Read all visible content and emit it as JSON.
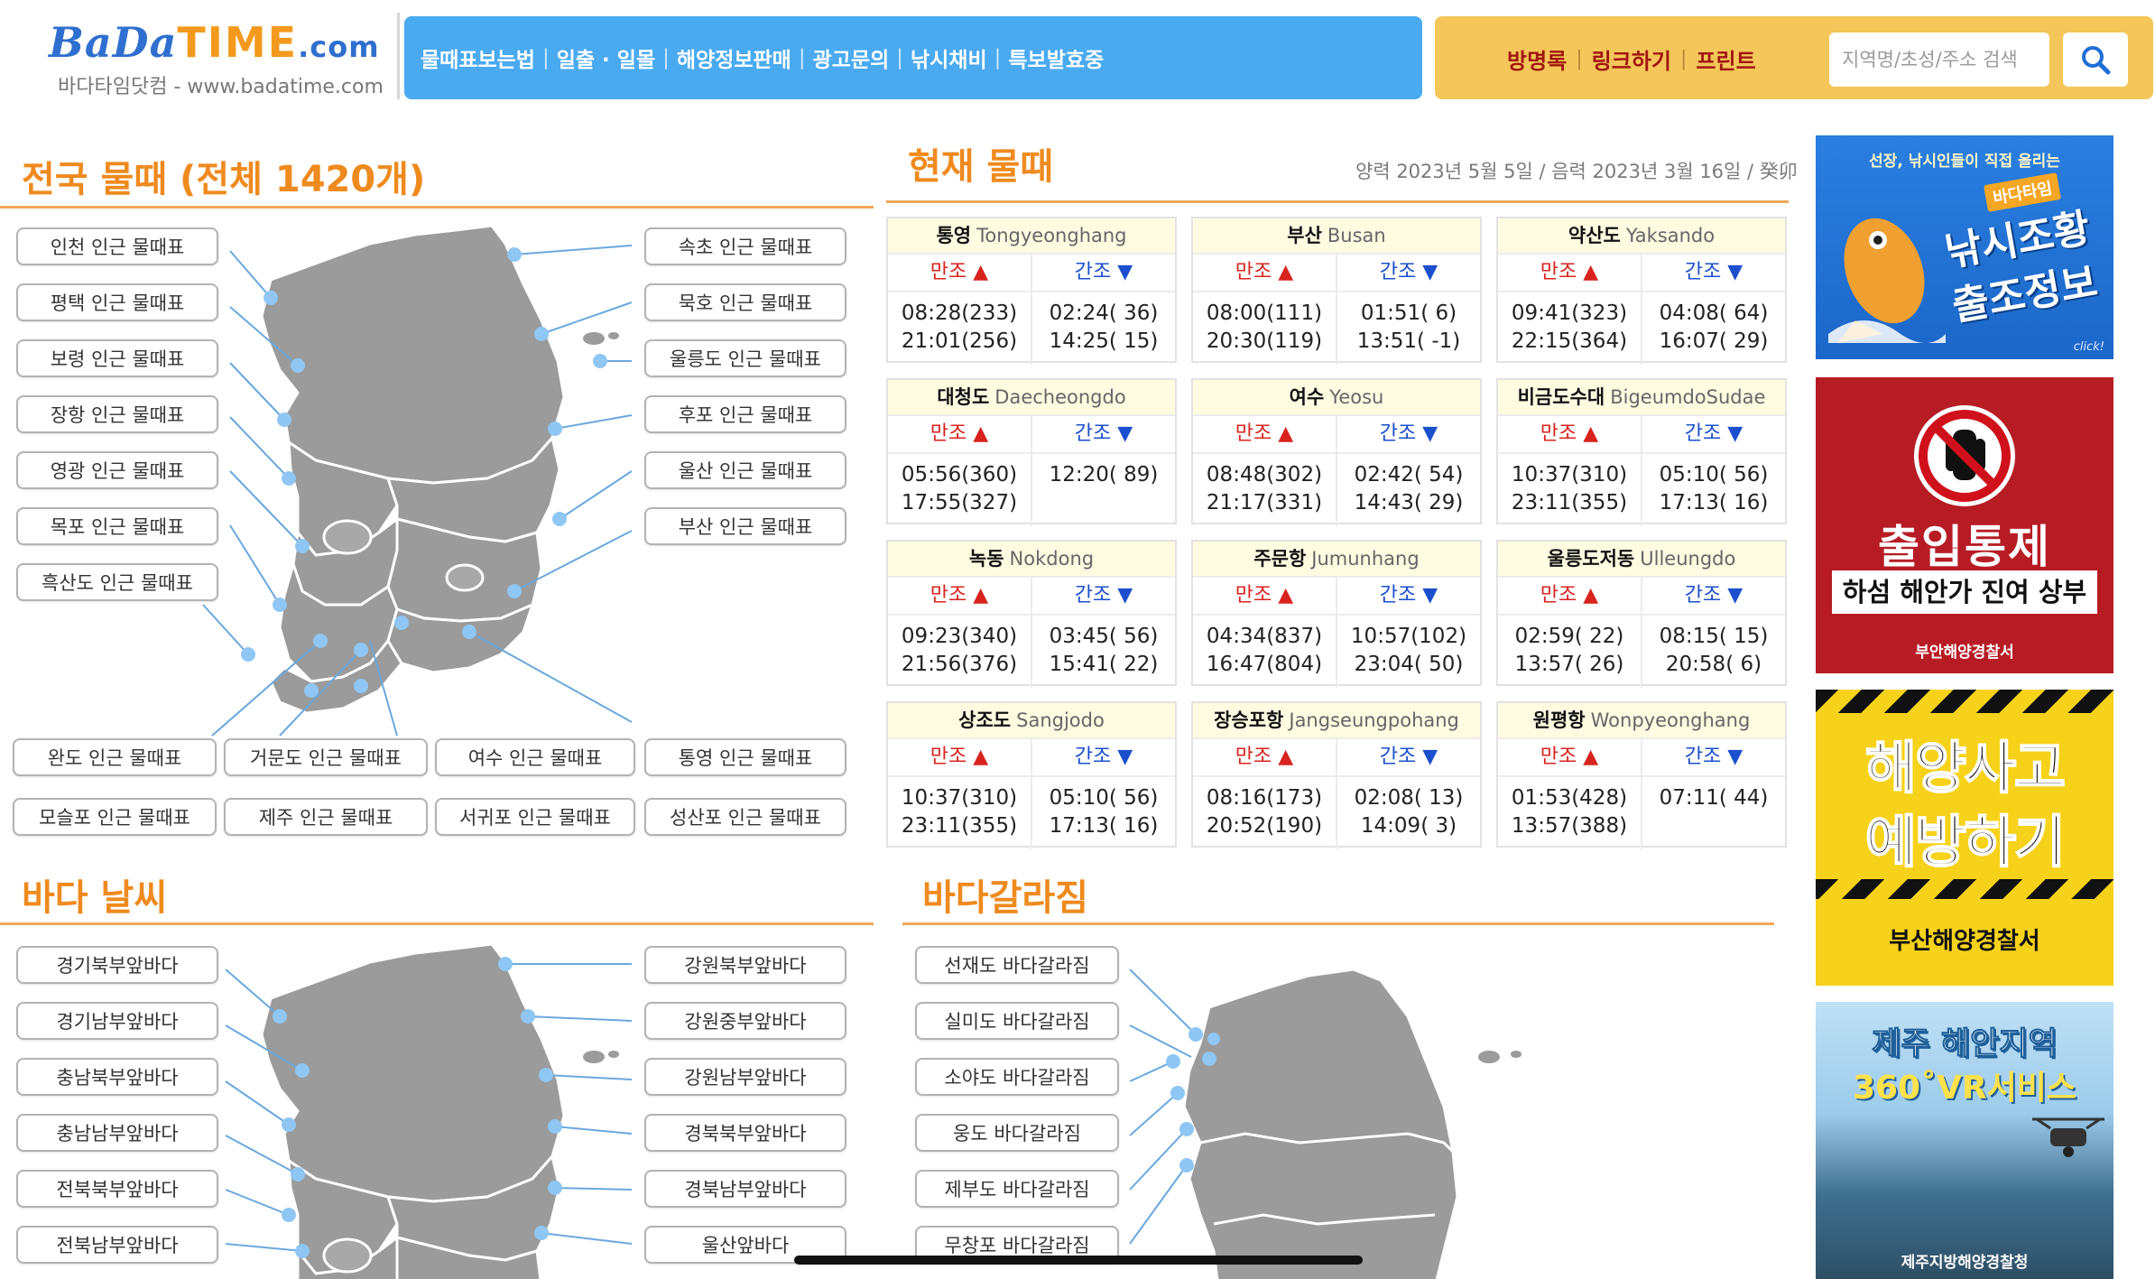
{
  "header": {
    "logo_main_1": "BaDa",
    "logo_main_2": "TIME",
    "logo_main_3": ".com",
    "logo_sub": "바다타임닷컴 - www.badatime.com",
    "nav": [
      "물때표보는법",
      "일출 · 일몰",
      "해양정보판매",
      "광고문의",
      "낚시채비",
      "특보발효중"
    ],
    "util_links": [
      "방명록",
      "링크하기",
      "프린트"
    ],
    "search_placeholder": "지역명/초성/주소 검색",
    "colors": {
      "nav_bg": "#4aaaf0",
      "util_bg": "#f5c659",
      "accent": "#ef8a1e"
    }
  },
  "tide_section": {
    "title": "전국 물때 (전체 1420개)",
    "left_buttons": [
      "인천 인근 물때표",
      "평택 인근 물때표",
      "보령 인근 물때표",
      "장항 인근 물때표",
      "영광 인근 물때표",
      "목포 인근 물때표",
      "흑산도 인근 물때표"
    ],
    "right_buttons": [
      "속초 인근 물때표",
      "묵호 인근 물때표",
      "울릉도 인근 물때표",
      "후포 인근 물때표",
      "울산 인근 물때표",
      "부산 인근 물때표"
    ],
    "bottom_row1": [
      "완도 인근 물때표",
      "거문도 인근 물때표",
      "여수 인근 물때표",
      "통영 인근 물때표"
    ],
    "bottom_row2": [
      "모슬포 인근 물때표",
      "제주 인근 물때표",
      "서귀포 인근 물때표",
      "성산포 인근 물때표"
    ]
  },
  "current": {
    "title": "현재 물때",
    "date": "양력 2023년 5월 5일 / 음력 2023년 3월 16일 / 癸卯",
    "high_label": "만조 ▲",
    "low_label": "간조 ▼",
    "stations": [
      {
        "ko": "통영",
        "en": "Tongyeonghang",
        "high": "08:28(233)\n21:01(256)",
        "low": "02:24( 36)\n14:25( 15)"
      },
      {
        "ko": "부산",
        "en": "Busan",
        "high": "08:00(111)\n20:30(119)",
        "low": "01:51(  6)\n13:51( -1)"
      },
      {
        "ko": "약산도",
        "en": "Yaksando",
        "high": "09:41(323)\n22:15(364)",
        "low": "04:08( 64)\n16:07( 29)"
      },
      {
        "ko": "대청도",
        "en": "Daecheongdo",
        "high": "05:56(360)\n17:55(327)",
        "low": "12:20( 89)"
      },
      {
        "ko": "여수",
        "en": "Yeosu",
        "high": "08:48(302)\n21:17(331)",
        "low": "02:42( 54)\n14:43( 29)"
      },
      {
        "ko": "비금도수대",
        "en": "BigeumdoSudae",
        "high": "10:37(310)\n23:11(355)",
        "low": "05:10( 56)\n17:13( 16)"
      },
      {
        "ko": "녹동",
        "en": "Nokdong",
        "high": "09:23(340)\n21:56(376)",
        "low": "03:45( 56)\n15:41( 22)"
      },
      {
        "ko": "주문항",
        "en": "Jumunhang",
        "high": "04:34(837)\n16:47(804)",
        "low": "10:57(102)\n23:04( 50)"
      },
      {
        "ko": "울릉도저동",
        "en": "Ulleungdo",
        "high": "02:59( 22)\n13:57( 26)",
        "low": "08:15( 15)\n20:58(  6)"
      },
      {
        "ko": "상조도",
        "en": "Sangjodo",
        "high": "10:37(310)\n23:11(355)",
        "low": "05:10( 56)\n17:13( 16)"
      },
      {
        "ko": "장승포항",
        "en": "Jangseungpohang",
        "high": "08:16(173)\n20:52(190)",
        "low": "02:08( 13)\n14:09(  3)"
      },
      {
        "ko": "원평항",
        "en": "Wonpyeonghang",
        "high": "01:53(428)\n13:57(388)",
        "low": "07:11( 44)"
      }
    ]
  },
  "weather": {
    "title": "바다 날씨",
    "left_buttons": [
      "경기북부앞바다",
      "경기남부앞바다",
      "충남북부앞바다",
      "충남남부앞바다",
      "전북북부앞바다",
      "전북남부앞바다"
    ],
    "right_buttons": [
      "강원북부앞바다",
      "강원중부앞바다",
      "강원남부앞바다",
      "경북북부앞바다",
      "경북남부앞바다",
      "울산앞바다"
    ]
  },
  "parting": {
    "title": "바다갈라짐",
    "buttons": [
      "선재도 바다갈라짐",
      "실미도 바다갈라짐",
      "소야도 바다갈라짐",
      "웅도 바다갈라짐",
      "제부도 바다갈라짐",
      "무창포 바다갈라짐"
    ]
  },
  "banners": {
    "b1_top": "선장, 낚시인들이 직접 올리는",
    "b1_badge": "바다타임",
    "b1_line1": "낚시조황",
    "b1_line2": "출조정보",
    "b1_click": "click!",
    "b2_title": "출입통제",
    "b2_sub": "하섬 해안가 진여 상부",
    "b2_org": "부안해양경찰서",
    "b3_line1": "해양사고",
    "b3_line2": "예방하기",
    "b3_org": "부산해양경찰서",
    "b4_line1": "제주 해안지역",
    "b4_line2": "360˚VR서비스",
    "b4_org": "제주지방해양경찰청"
  }
}
